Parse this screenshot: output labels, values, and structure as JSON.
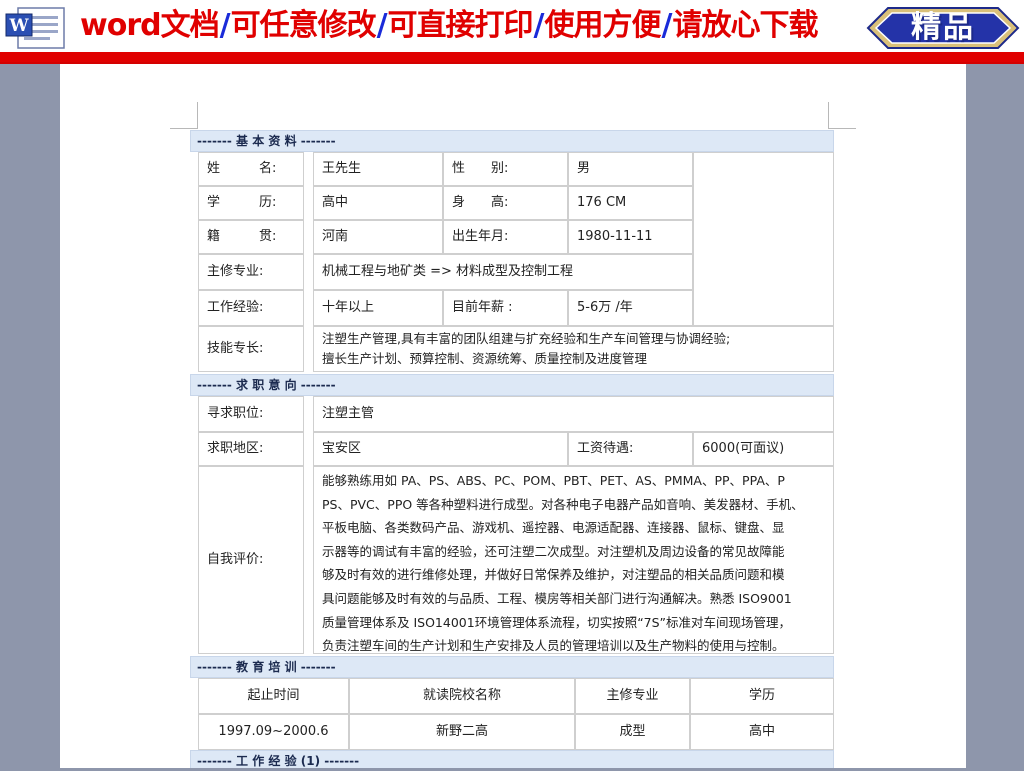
{
  "banner": {
    "segments": [
      "word文档",
      "/",
      "可任意修改",
      "/",
      "可直接打印",
      "/",
      "使用方便",
      "/",
      "请放心下载"
    ],
    "badge": "精品",
    "word_icon": "word-document-icon"
  },
  "colors": {
    "banner_red": "#e00000",
    "banner_blue": "#1a2bd9",
    "section_bg": "#dde8f6",
    "page_bg": "#8e96ab"
  },
  "basic": {
    "header": "------- 基 本 资 料 -------",
    "name_label": "姓　　　名:",
    "name": "王先生",
    "gender_label": "性　　别:",
    "gender": "男",
    "edu_label": "学　　　历:",
    "edu": "高中",
    "height_label": "身　　高:",
    "height": "176 CM",
    "origin_label": "籍　　　贯:",
    "origin": "河南",
    "birth_label": "出生年月:",
    "birth": "1980-11-11",
    "major_label": "主修专业:",
    "major": "机械工程与地矿类 => 材料成型及控制工程",
    "exp_label": "工作经验:",
    "exp": "十年以上",
    "salary_label": "目前年薪 :",
    "salary": "5-6万 /年",
    "skills_label": "技能专长:",
    "skills": [
      "注塑生产管理,具有丰富的团队组建与扩充经验和生产车间管理与协调经验;",
      "擅长生产计划、预算控制、资源统筹、质量控制及进度管理"
    ]
  },
  "intent": {
    "header": "------- 求 职 意 向 -------",
    "position_label": "寻求职位:",
    "position": "注塑主管",
    "area_label": "求职地区:",
    "area": "宝安区",
    "pay_label": "工资待遇:",
    "pay": "6000(可面议)",
    "self_label": "自我评价:",
    "self": [
      "能够熟练用如 PA、PS、ABS、PC、POM、PBT、PET、AS、PMMA、PP、PPA、P",
      "PS、PVC、PPO 等各种塑料进行成型。对各种电子电器产品如音响、美发器材、手机、",
      "平板电脑、各类数码产品、游戏机、遥控器、电源适配器、连接器、鼠标、键盘、显",
      "示器等的调试有丰富的经验，还可注塑二次成型。对注塑机及周边设备的常见故障能",
      "够及时有效的进行维修处理，并做好日常保养及维护，对注塑品的相关品质问题和模",
      "具问题能够及时有效的与品质、工程、模房等相关部门进行沟通解决。熟悉 ISO9001",
      "质量管理体系及 ISO14001环境管理体系流程，切实按照“7S”标准对车间现场管理，",
      "负责注塑车间的生产计划和生产安排及人员的管理培训以及生产物料的使用与控制。"
    ]
  },
  "education": {
    "header": "------- 教 育 培 训 -------",
    "columns": [
      "起止时间",
      "就读院校名称",
      "主修专业",
      "学历"
    ],
    "rows": [
      [
        "1997.09~2000.6",
        "新野二高",
        "成型",
        "高中"
      ]
    ]
  },
  "work": {
    "header": "------- 工 作 经 验 (1) -------"
  }
}
